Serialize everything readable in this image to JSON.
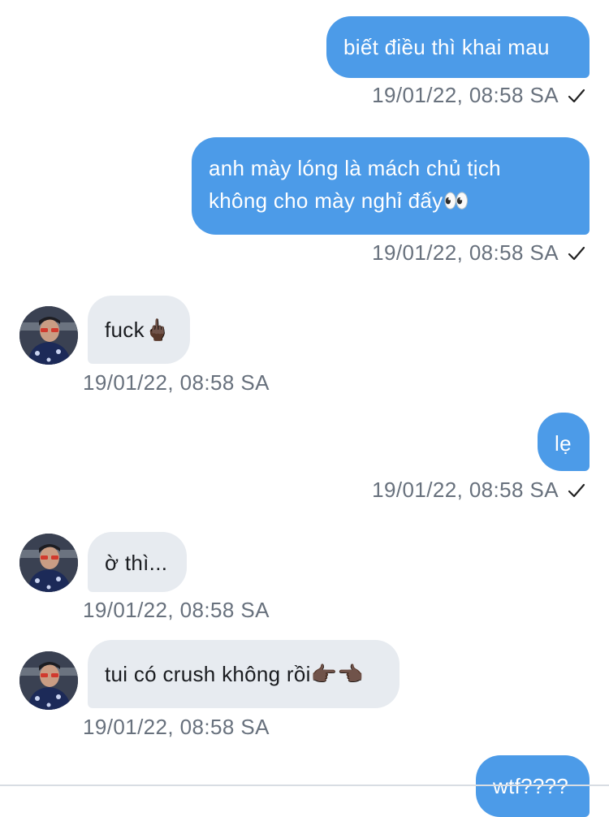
{
  "messages": [
    {
      "direction": "outgoing",
      "text": "biết điều thì khai mau",
      "timestamp": "19/01/22, 08:58 SA",
      "read_receipt": "check-icon"
    },
    {
      "direction": "outgoing",
      "text": "anh mày lóng là mách chủ tịch\nkhông cho mày nghỉ đấy👀",
      "timestamp": "19/01/22, 08:58 SA",
      "read_receipt": "check-icon"
    },
    {
      "direction": "incoming",
      "text": "fuck🖕🏿",
      "timestamp": "19/01/22, 08:58 SA"
    },
    {
      "direction": "outgoing",
      "text": "lẹ",
      "timestamp": "19/01/22, 08:58 SA",
      "read_receipt": "check-icon"
    },
    {
      "direction": "incoming",
      "text": "ờ thì...",
      "timestamp": "19/01/22, 08:58 SA"
    },
    {
      "direction": "incoming",
      "text": "tui có crush không rồi👉🏿👈🏿",
      "timestamp": "19/01/22, 08:58 SA"
    },
    {
      "direction": "outgoing",
      "text": "wtf????"
    }
  ],
  "colors": {
    "outgoing_bubble": "#4c9be8",
    "incoming_bubble": "#e7ebf0",
    "timestamp": "#68717d"
  }
}
